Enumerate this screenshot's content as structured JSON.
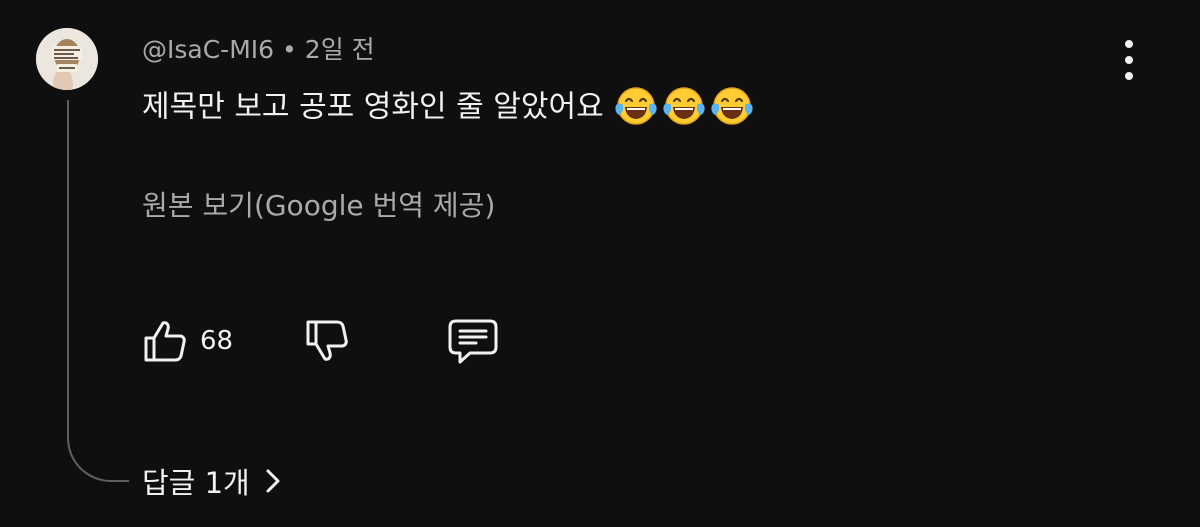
{
  "comment": {
    "author": "@IsaC-MI6",
    "separator": "•",
    "time": "2일 전",
    "text": "제목만 보고 공포 영화인 줄 알았어요",
    "emojis": [
      "face-with-tears-of-joy",
      "face-with-tears-of-joy",
      "face-with-tears-of-joy"
    ],
    "translate_label": "원본 보기(Google 번역 제공)",
    "like_count": "68",
    "replies_label": "답글 1개"
  },
  "icons": {
    "like": "thumbs-up-icon",
    "dislike": "thumbs-down-icon",
    "reply": "comment-icon",
    "more": "vertical-ellipsis-icon",
    "replies_arrow": "chevron-right-icon"
  },
  "colors": {
    "background": "#0f0f0f",
    "primary_text": "#f1f1f1",
    "secondary_text": "#aaaaaa",
    "thread_line": "#606060",
    "emoji_face": "#ffcc33"
  }
}
